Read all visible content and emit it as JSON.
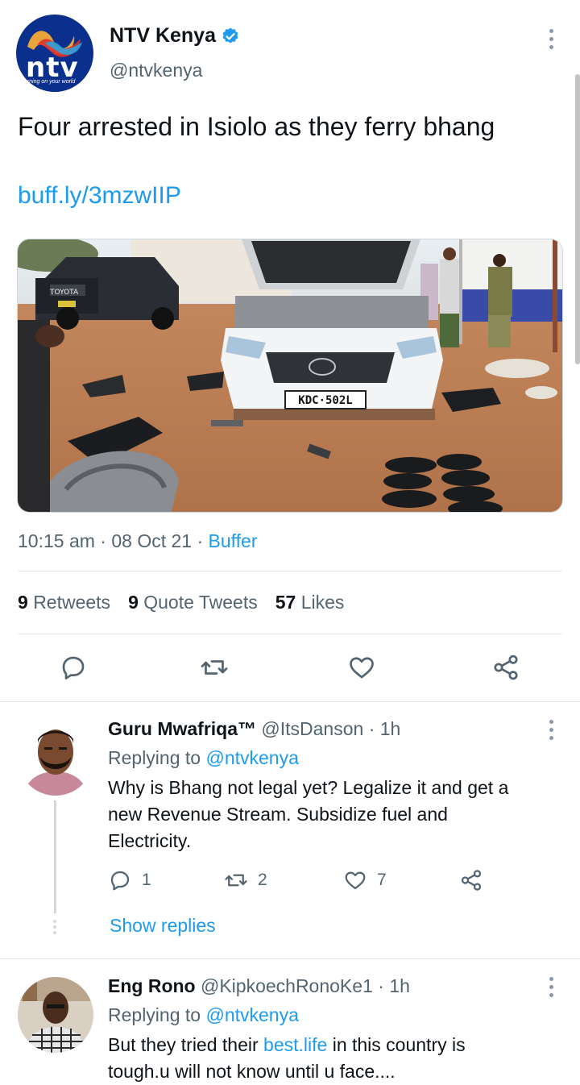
{
  "tweet": {
    "author_name": "NTV Kenya",
    "author_handle": "@ntvkenya",
    "avatar_wordmark": "ntv",
    "avatar_tagline": "turning on your world",
    "text": "Four arrested in Isiolo as they ferry bhang",
    "link": "buff.ly/3mzwIIP",
    "photo": {
      "plate": "KDC·502L",
      "truck_badge": "TOYOTA"
    },
    "time": "10:15 am",
    "date": "08 Oct 21",
    "source": "Buffer",
    "retweets_count": "9",
    "retweets_label": "Retweets",
    "quotes_count": "9",
    "quotes_label": "Quote Tweets",
    "likes_count": "57",
    "likes_label": "Likes",
    "actions": [
      "reply-icon",
      "retweet-icon",
      "like-icon",
      "share-icon"
    ]
  },
  "replies": [
    {
      "name": "Guru Mwafriqa™",
      "handle": "@ItsDanson",
      "age": "1h",
      "replying_prefix": "Replying to",
      "replying_to": "@ntvkenya",
      "text_line1": "Why is Bhang not legal yet? Legalize it and get a",
      "text_line2": "new Revenue Stream. Subsidize fuel and",
      "text_line3": "Electricity.",
      "reply_count": "1",
      "retweet_count": "2",
      "like_count": "7",
      "show_replies": "Show replies"
    },
    {
      "name": "Eng Rono",
      "handle": "@KipkoechRonoKe1",
      "age": "1h",
      "replying_prefix": "Replying to",
      "replying_to": "@ntvkenya",
      "text_pre": "But they tried their ",
      "text_link": "best.life",
      "text_post": " in this country is",
      "text_line2": "tough.u will not know until u face...."
    }
  ],
  "colors": {
    "accent": "#1d9bf0",
    "secondary_text": "#536471",
    "primary_text": "#0f1419",
    "ntv_blue": "#0a2f8c"
  }
}
